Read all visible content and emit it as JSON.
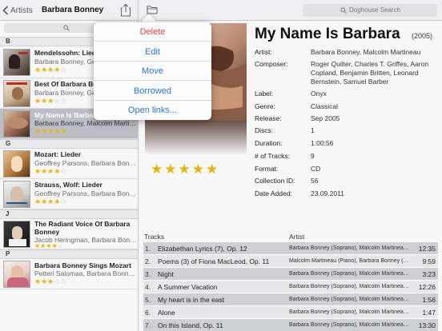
{
  "left_nav": {
    "back_label": "Artists",
    "title": "Barbara Bonney"
  },
  "sections": [
    {
      "letter": "B"
    },
    {
      "letter": "G"
    },
    {
      "letter": "J"
    },
    {
      "letter": "P"
    }
  ],
  "albums": [
    {
      "title": "Mendelssohn: Lieder",
      "artist": "Barbara Bonney, Geoffrey Parsons",
      "rating": 4
    },
    {
      "title": "Best Of Barbara Bonney",
      "artist": "Barbara Bonney, Geoffrey Parsons",
      "rating": 3
    },
    {
      "title": "My Name Is Barbara",
      "artist": "Barbara Bonney, Malcolm Martineau",
      "rating": 5
    },
    {
      "title": "Mozart: Lieder",
      "artist": "Geoffrey Parsons, Barbara Bonney",
      "rating": 4
    },
    {
      "title": "Strauss, Wolf: Lieder",
      "artist": "Geoffrey Parsons, Barbara Bonney",
      "rating": 4
    },
    {
      "title": "The Radiant Voice Of Barbara Bonney",
      "artist": "Jacob Heringman, Barbara Bonney",
      "rating": 4
    },
    {
      "title": "Barbara Bonney Sings Mozart",
      "artist": "Petteri Salomaa, Barbara Bonney,...",
      "rating": 3
    }
  ],
  "right_nav": {
    "search_placeholder": "Doghouse Search"
  },
  "popover": {
    "items": [
      "Delete",
      "Edit",
      "Move",
      "Borrowed",
      "Open links..."
    ]
  },
  "detail": {
    "title": "My Name Is Barbara",
    "year": "(2005)",
    "rating": 5,
    "fields": [
      {
        "label": "Artist:",
        "value": "Barbara Bonney, Malcolm Martineau"
      },
      {
        "label": "Composer:",
        "value": "Roger Quilter, Charles T. Griffes, Aaron Copland, Benjamin Britten, Leonard Bernstein, Samuel Barber"
      },
      {
        "label": "Label:",
        "value": "Onyx"
      },
      {
        "label": "Genre:",
        "value": "Classical"
      },
      {
        "label": "Release:",
        "value": "Sep 2005"
      },
      {
        "label": "Discs:",
        "value": "1"
      },
      {
        "label": "Duration:",
        "value": "1:00:56"
      },
      {
        "label": "# of Tracks:",
        "value": "9"
      },
      {
        "label": "Format:",
        "value": "CD"
      },
      {
        "label": "Collection ID:",
        "value": "56"
      },
      {
        "label": "Date Added:",
        "value": "23.09.2011"
      }
    ]
  },
  "tracks": {
    "header_tracks": "Tracks",
    "header_artist": "Artist",
    "rows": [
      {
        "num": "1.",
        "title": "Elizabethan Lyrics (7), Op. 12",
        "artist": "Barbara Bonney (Soprano), Malcolm Martineau (...",
        "duration": "12:35"
      },
      {
        "num": "2.",
        "title": "Poems (3) of Fiona MacLeod, Op. 11",
        "artist": "Malcolm Martineau (Piano), Barbara Bonney (Soprano)",
        "duration": "9:59"
      },
      {
        "num": "3.",
        "title": "Night",
        "artist": "Barbara Bonney (Soprano), Malcolm Martineau (...",
        "duration": "3:23"
      },
      {
        "num": "4.",
        "title": "A Summer Vacation",
        "artist": "Barbara Bonney (Soprano), Malcolm Martineau (...",
        "duration": "12:26"
      },
      {
        "num": "5.",
        "title": "My heart is in the east",
        "artist": "Barbara Bonney (Soprano), Malcolm Martineau (...",
        "duration": "1:56"
      },
      {
        "num": "6.",
        "title": "Alone",
        "artist": "Barbara Bonney (Soprano), Malcolm Martineau (...",
        "duration": "1:47"
      },
      {
        "num": "7.",
        "title": "On this Island, Op. 11",
        "artist": "Barbara Bonney (Soprano), Malcolm Martineau (...",
        "duration": "13:30"
      }
    ]
  },
  "colors": {
    "accent_blue": "#2a72d9",
    "danger_red": "#e2463a",
    "star_gold": "#e9b30b"
  }
}
